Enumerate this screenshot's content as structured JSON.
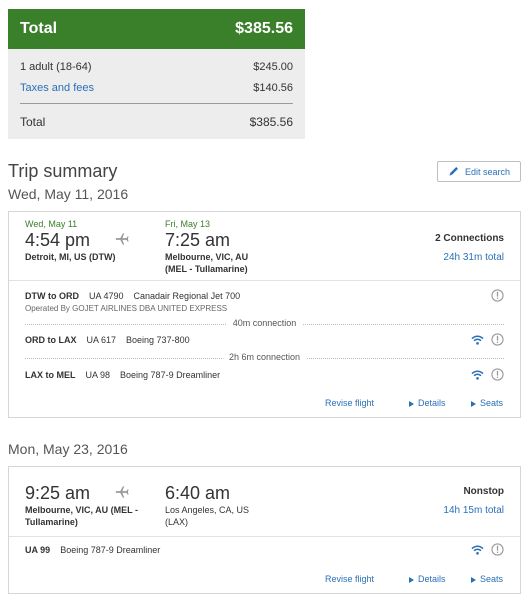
{
  "summary": {
    "total_label": "Total",
    "total_amount": "$385.56",
    "lines": [
      {
        "label": "1 adult (18-64)",
        "amount": "$245.00"
      },
      {
        "label": "Taxes and fees",
        "amount": "$140.56"
      }
    ],
    "footer_label": "Total",
    "footer_amount": "$385.56"
  },
  "trip": {
    "title": "Trip summary",
    "edit_label": "Edit search"
  },
  "flights": [
    {
      "date": "Wed, May 11, 2016",
      "dep_date": "Wed, May 11",
      "dep_time": "4:54 pm",
      "dep_city": "Detroit, MI, US (DTW)",
      "arr_date": "Fri, May 13",
      "arr_time": "7:25 am",
      "arr_city_1": "Melbourne, VIC, AU",
      "arr_city_2": "(MEL - Tullamarine)",
      "connections": "2 Connections",
      "duration": "24h 31m total",
      "segments": [
        {
          "route": "DTW to ORD",
          "flight": "UA 4790",
          "aircraft": "Canadair Regional Jet 700",
          "operated": "Operated By GOJET AIRLINES DBA UNITED EXPRESS"
        },
        {
          "route": "ORD to LAX",
          "flight": "UA 617",
          "aircraft": "Boeing 737-800"
        },
        {
          "route": "LAX to MEL",
          "flight": "UA 98",
          "aircraft": "Boeing 787-9 Dreamliner"
        }
      ],
      "layovers": [
        "40m connection",
        "2h 6m connection"
      ],
      "revise": "Revise flight",
      "details": "Details",
      "seats": "Seats"
    },
    {
      "date": "Mon, May 23, 2016",
      "dep_time": "9:25 am",
      "dep_city_1": "Melbourne, VIC, AU (MEL -",
      "dep_city_2": "Tullamarine)",
      "arr_time": "6:40 am",
      "arr_city_1": "Los Angeles, CA, US",
      "arr_city_2": "(LAX)",
      "connections": "Nonstop",
      "duration": "14h 15m total",
      "segments": [
        {
          "flight": "UA 99",
          "aircraft": "Boeing 787-9 Dreamliner"
        }
      ],
      "revise": "Revise flight",
      "details": "Details",
      "seats": "Seats"
    }
  ],
  "colors": {
    "brand_green": "#3a7f2a",
    "link_blue": "#2a6fb8"
  },
  "icons": [
    "airplane-icon",
    "wifi-icon",
    "info-icon",
    "pencil-icon",
    "triangle-right-icon"
  ]
}
